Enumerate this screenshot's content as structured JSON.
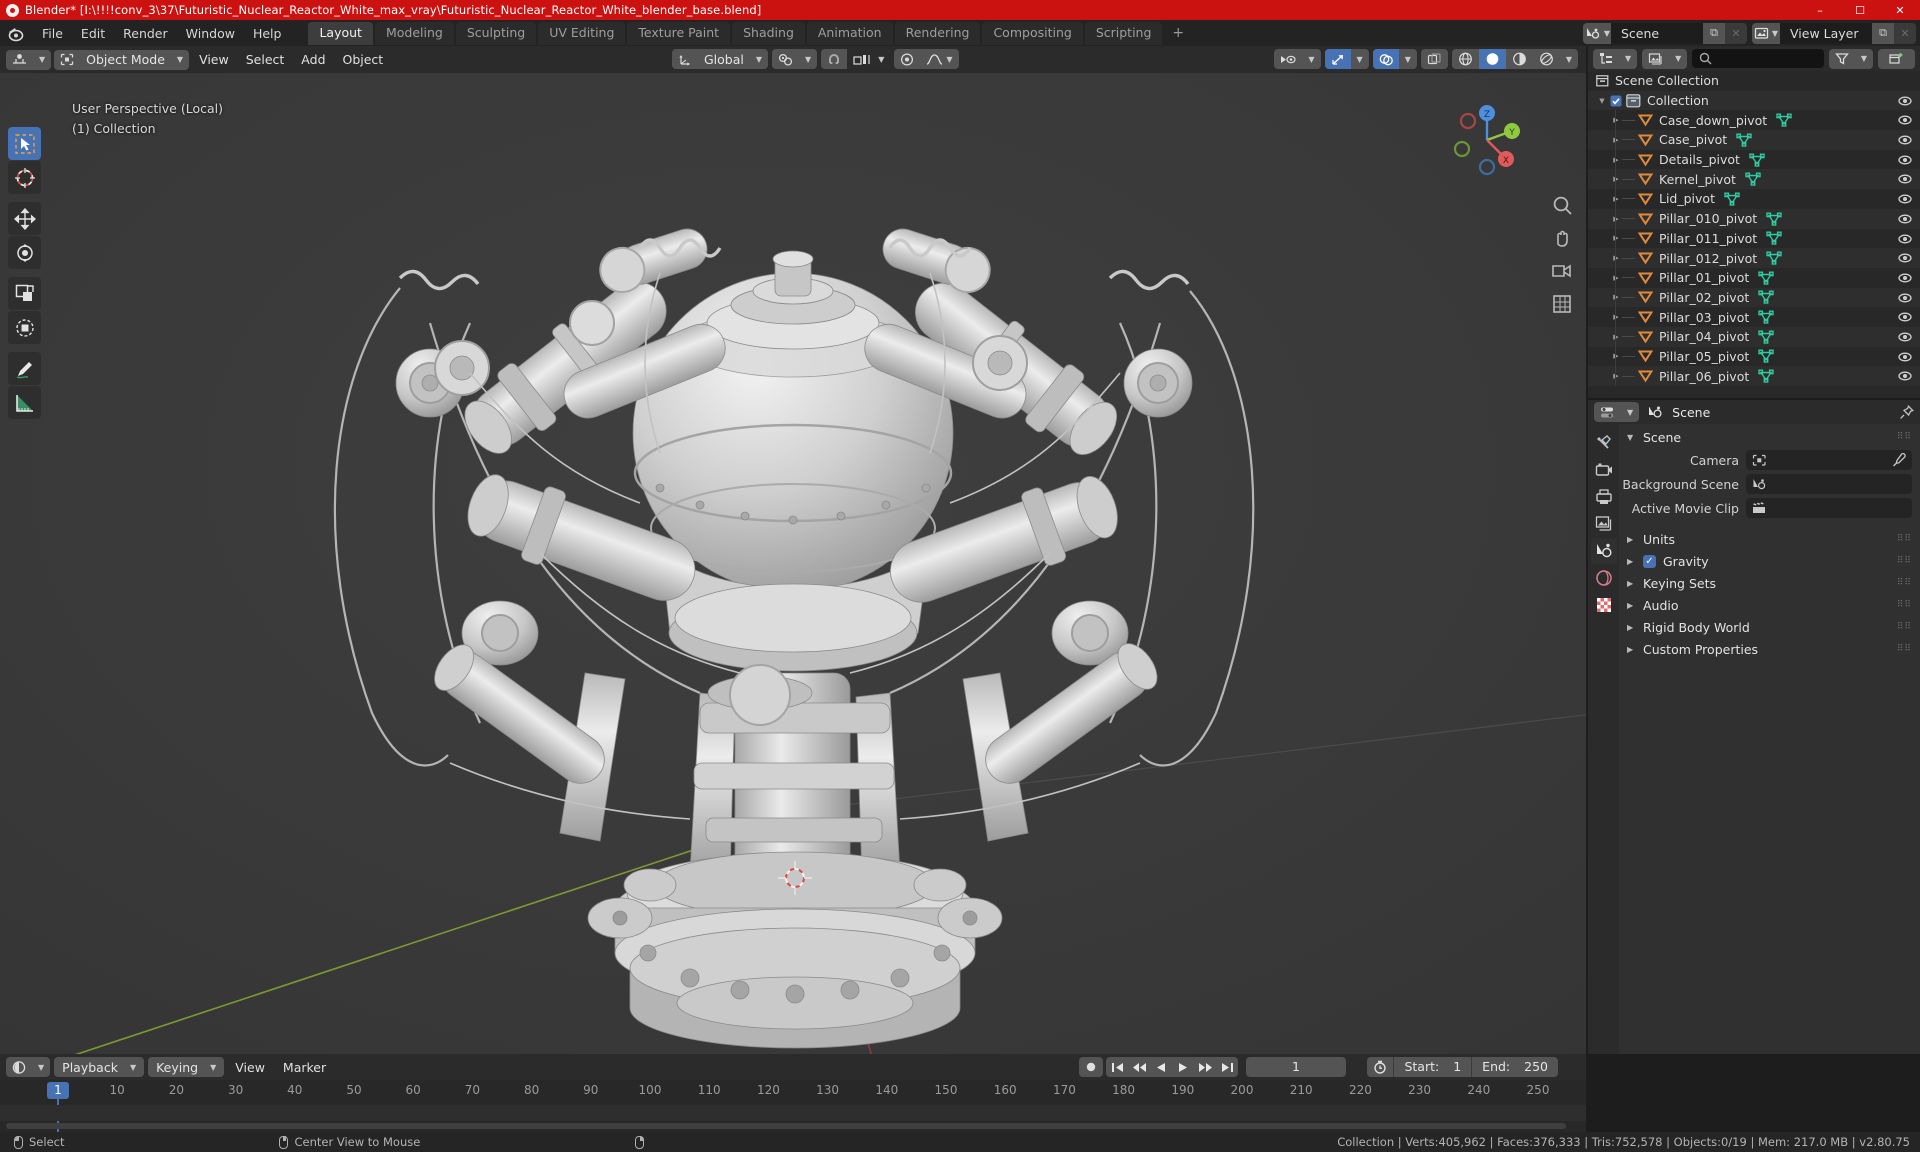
{
  "window": {
    "title": "Blender* [I:\\!!!!conv_3\\37\\Futuristic_Nuclear_Reactor_White_max_vray\\Futuristic_Nuclear_Reactor_White_blender_base.blend]",
    "minimize": "–",
    "maximize": "☐",
    "close": "✕",
    "accent": "#cc1111"
  },
  "topbar": {
    "menus": [
      "File",
      "Edit",
      "Render",
      "Window",
      "Help"
    ],
    "workspaces": [
      {
        "label": "Layout",
        "active": true
      },
      {
        "label": "Modeling",
        "active": false
      },
      {
        "label": "Sculpting",
        "active": false
      },
      {
        "label": "UV Editing",
        "active": false
      },
      {
        "label": "Texture Paint",
        "active": false
      },
      {
        "label": "Shading",
        "active": false
      },
      {
        "label": "Animation",
        "active": false
      },
      {
        "label": "Rendering",
        "active": false
      },
      {
        "label": "Compositing",
        "active": false
      },
      {
        "label": "Scripting",
        "active": false
      }
    ],
    "add_workspace": "+",
    "scene_name": "Scene",
    "view_layer_name": "View Layer",
    "new_btn": "⧉",
    "remove_btn": "✕"
  },
  "viewport": {
    "editor_type_icon": "editor-type-3dview-icon",
    "mode": "Object Mode",
    "menus": [
      "View",
      "Select",
      "Add",
      "Object"
    ],
    "transform_orientation": "Global",
    "pivot_icon": "pivot-point-icon",
    "snap_icon": "snap-magnet-icon",
    "snap_target_icon": "snap-increment-icon",
    "proportional_icon": "proportional-edit-icon",
    "falloff_icon": "proportional-falloff-icon",
    "overlay_text_line1": "User Perspective (Local)",
    "overlay_text_line2": "(1) Collection",
    "tools": [
      {
        "name": "tweak-select-box",
        "selected": true
      },
      {
        "name": "cursor",
        "selected": false
      },
      {
        "name": "move",
        "selected": false
      },
      {
        "name": "rotate",
        "selected": false
      },
      {
        "name": "scale",
        "selected": false
      },
      {
        "name": "transform",
        "selected": false
      },
      {
        "name": "annotate",
        "selected": false
      },
      {
        "name": "measure",
        "selected": false
      }
    ],
    "gizmo_axes": [
      {
        "label": "X",
        "color": "#e05a5a"
      },
      {
        "label": "Y",
        "color": "#8fc940"
      },
      {
        "label": "Z",
        "color": "#4f8fe0"
      }
    ],
    "right_header": {
      "visibility_icon": "object-visibility-icon",
      "gizmo_icon": "gizmo-icon",
      "overlays_icon": "overlays-icon",
      "xray_icon": "x-ray-toggle-icon",
      "shading_modes": [
        "wireframe",
        "solid",
        "material-preview",
        "rendered"
      ],
      "shading_active": "solid"
    }
  },
  "outliner": {
    "display_mode_icon": "outliner-display-mode-icon",
    "filter_id_icon": "outliner-id-type-icon",
    "search_placeholder": "",
    "filter_icon": "filter-funnel-icon",
    "new_collection_icon": "new-collection-icon",
    "root": "Scene Collection",
    "collection": "Collection",
    "items": [
      {
        "label": "Case_down_pivot",
        "indent": 2
      },
      {
        "label": "Case_pivot",
        "indent": 2
      },
      {
        "label": "Details_pivot",
        "indent": 2
      },
      {
        "label": "Kernel_pivot",
        "indent": 2
      },
      {
        "label": "Lid_pivot",
        "indent": 2
      },
      {
        "label": "Pillar_010_pivot",
        "indent": 2
      },
      {
        "label": "Pillar_011_pivot",
        "indent": 2
      },
      {
        "label": "Pillar_012_pivot",
        "indent": 2
      },
      {
        "label": "Pillar_01_pivot",
        "indent": 2
      },
      {
        "label": "Pillar_02_pivot",
        "indent": 2
      },
      {
        "label": "Pillar_03_pivot",
        "indent": 2
      },
      {
        "label": "Pillar_04_pivot",
        "indent": 2
      },
      {
        "label": "Pillar_05_pivot",
        "indent": 2
      },
      {
        "label": "Pillar_06_pivot",
        "indent": 2
      }
    ]
  },
  "properties": {
    "breadcrumb_icon": "scene-properties-icon",
    "breadcrumb": "Scene",
    "pin_icon": "pin-icon",
    "tabs": [
      {
        "name": "tool-tab",
        "icon": "wrench-screwdriver-icon",
        "selected": false
      },
      {
        "name": "render-tab",
        "icon": "camera-back-icon",
        "selected": false
      },
      {
        "name": "output-tab",
        "icon": "printer-icon",
        "selected": false
      },
      {
        "name": "view-layer-tab",
        "icon": "images-icon",
        "selected": false
      },
      {
        "name": "scene-tab",
        "icon": "scene-cone-icon",
        "selected": true
      },
      {
        "name": "world-tab",
        "icon": "world-globe-icon",
        "selected": false
      },
      {
        "name": "texture-tab",
        "icon": "checker-texture-icon",
        "selected": false
      }
    ],
    "panel_title": "Scene",
    "rows": [
      {
        "label": "Camera",
        "value": "",
        "icon": "camera-field-icon",
        "eyedropper": true
      },
      {
        "label": "Background Scene",
        "value": "",
        "icon": "scene-field-icon",
        "eyedropper": false
      },
      {
        "label": "Active Movie Clip",
        "value": "",
        "icon": "clip-field-icon",
        "eyedropper": false
      }
    ],
    "panels": [
      {
        "label": "Units",
        "checkbox": false
      },
      {
        "label": "Gravity",
        "checkbox": true
      },
      {
        "label": "Keying Sets",
        "checkbox": false
      },
      {
        "label": "Audio",
        "checkbox": false
      },
      {
        "label": "Rigid Body World",
        "checkbox": false
      },
      {
        "label": "Custom Properties",
        "checkbox": false
      }
    ]
  },
  "timeline": {
    "editor_icon": "timeline-editor-icon",
    "menus": [
      "Playback",
      "Keying",
      "View",
      "Marker"
    ],
    "record_icon": "auto-keying-record-icon",
    "transport": [
      "jump-start",
      "prev-keyframe",
      "play-reverse",
      "play",
      "next-keyframe",
      "jump-end"
    ],
    "current_frame": "1",
    "timer_icon": "use-preview-range-icon",
    "start_label": "Start:",
    "start_value": "1",
    "end_label": "End:",
    "end_value": "250",
    "ticks": [
      "1",
      "10",
      "20",
      "30",
      "40",
      "50",
      "60",
      "70",
      "80",
      "90",
      "100",
      "110",
      "120",
      "130",
      "140",
      "150",
      "160",
      "170",
      "180",
      "190",
      "200",
      "210",
      "220",
      "230",
      "240",
      "250"
    ],
    "playhead_frame": "1"
  },
  "statusbar": {
    "left_items": [
      {
        "icon": "mouse-left-icon",
        "label": "Select"
      },
      {
        "icon": "mouse-middle-icon",
        "label": "Center View to Mouse"
      },
      {
        "icon": "mouse-right-icon",
        "label": ""
      }
    ],
    "scene_stats": "Collection | Verts:405,962 | Faces:376,333 | Tris:752,578 | Objects:0/19 | Mem: 217.0 MB | v2.80.75"
  }
}
